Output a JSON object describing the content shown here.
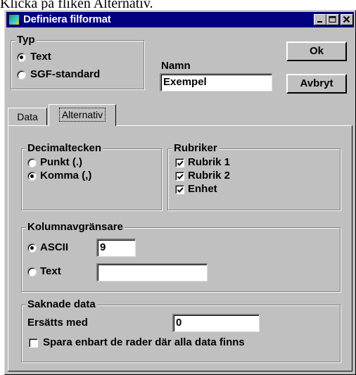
{
  "caption": {
    "text": "Klicka på fliken Alternativ."
  },
  "window": {
    "title": "Definiera filformat",
    "title_bar_color": "#000080"
  },
  "typ": {
    "legend": "Typ",
    "options": [
      {
        "label": "Text",
        "selected": true
      },
      {
        "label": "SGF-standard",
        "selected": false
      }
    ]
  },
  "namn": {
    "label": "Namn",
    "value": "Exempel"
  },
  "buttons": {
    "ok": "Ok",
    "cancel": "Avbryt"
  },
  "tabs": [
    {
      "label": "Data",
      "active": false
    },
    {
      "label": "Alternativ",
      "active": true
    }
  ],
  "decimal": {
    "legend": "Decimaltecken",
    "options": [
      {
        "label": "Punkt (.)",
        "selected": false
      },
      {
        "label": "Komma (,)",
        "selected": true
      }
    ]
  },
  "rubriker": {
    "legend": "Rubriker",
    "items": [
      {
        "label": "Rubrik 1",
        "checked": true
      },
      {
        "label": "Rubrik 2",
        "checked": true
      },
      {
        "label": "Enhet",
        "checked": true
      }
    ]
  },
  "kolumn": {
    "legend": "Kolumnavgränsare",
    "ascii_label": "ASCII",
    "ascii_value": "9",
    "ascii_selected": true,
    "text_label": "Text",
    "text_value": "",
    "text_selected": false
  },
  "saknade": {
    "legend": "Saknade data",
    "ersatts_label": "Ersätts med",
    "ersatts_value": "0",
    "spara_label": "Spara enbart de rader där alla data finns",
    "spara_checked": false
  }
}
